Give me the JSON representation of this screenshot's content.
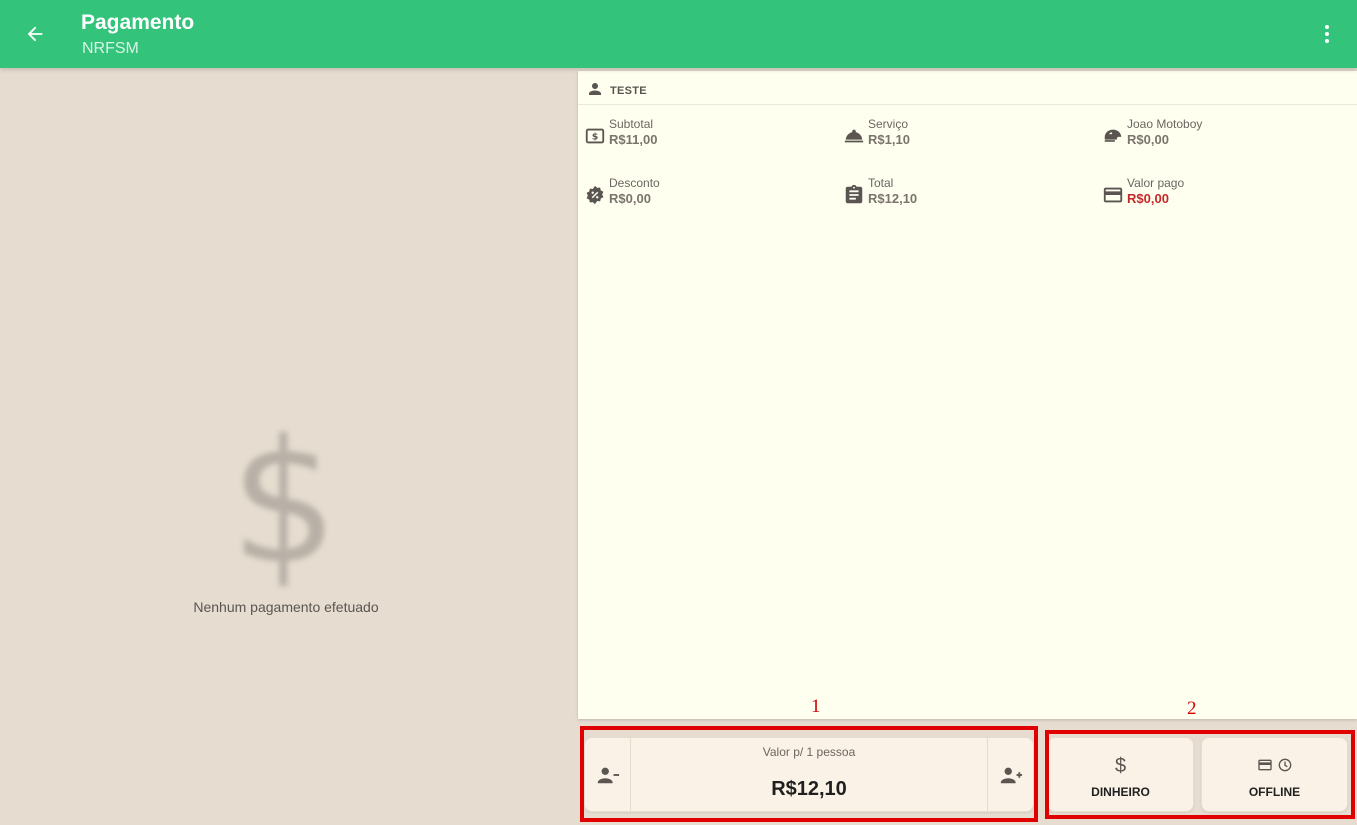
{
  "header": {
    "title": "Pagamento",
    "subtitle": "NRFSM"
  },
  "left_panel": {
    "empty_icon": "$",
    "empty_message": "Nenhum pagamento efetuado"
  },
  "card": {
    "customer_name": "TESTE",
    "items": [
      {
        "label": "Subtotal",
        "value": "R$11,00",
        "icon": "money-bill-icon"
      },
      {
        "label": "Serviço",
        "value": "R$1,10",
        "icon": "service-bell-icon"
      },
      {
        "label": "Joao Motoboy",
        "value": "R$0,00",
        "icon": "helmet-icon"
      },
      {
        "label": "Desconto",
        "value": "R$0,00",
        "icon": "discount-badge-icon"
      },
      {
        "label": "Total",
        "value": "R$12,10",
        "icon": "clipboard-icon"
      },
      {
        "label": "Valor pago",
        "value": "R$0,00",
        "icon": "credit-card-icon",
        "value_color": "#c62828"
      }
    ]
  },
  "split": {
    "label": "Valor p/ 1 pessoa",
    "value": "R$12,10"
  },
  "payment_buttons": {
    "cash_label": "DINHEIRO",
    "cash_icon": "$",
    "offline_label": "OFFLINE"
  },
  "callouts": {
    "one": "1",
    "two": "2"
  },
  "colors": {
    "header": "#33c37a",
    "background": "#e6ddd0",
    "card": "#fffff0",
    "highlight": "#e00000",
    "paid_value": "#c62828"
  }
}
